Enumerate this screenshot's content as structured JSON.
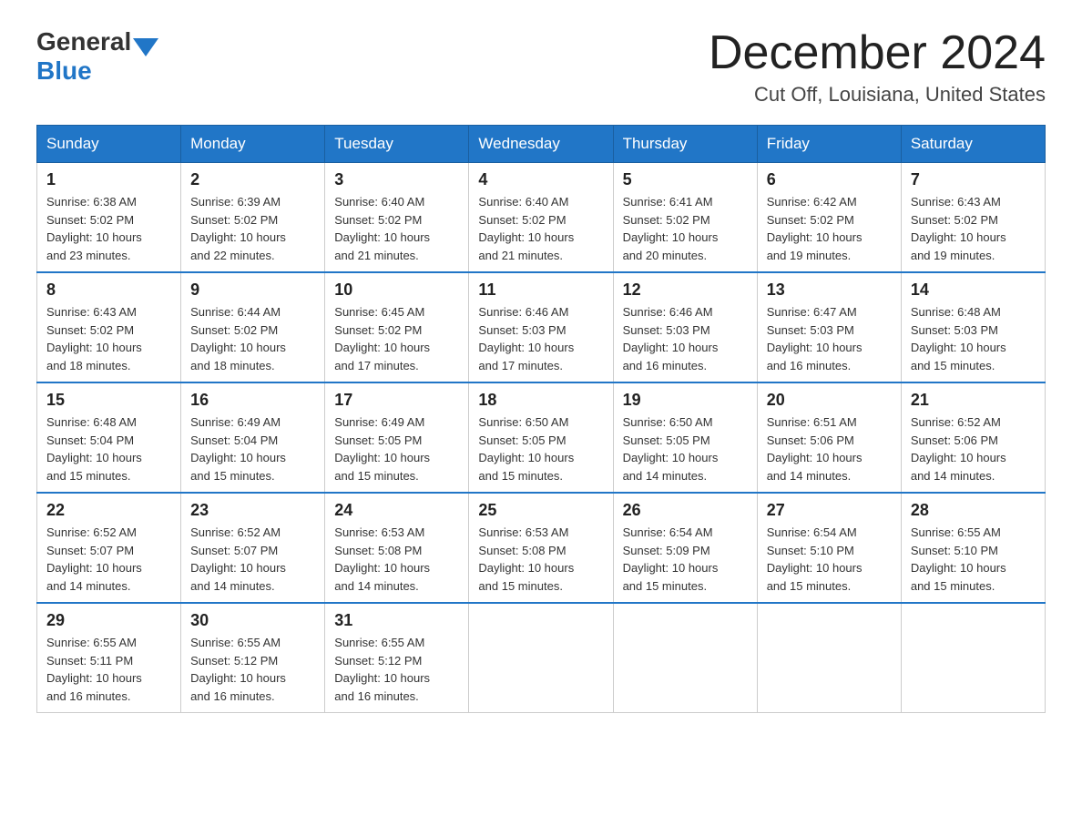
{
  "logo": {
    "general": "General",
    "blue": "Blue"
  },
  "title": {
    "month": "December 2024",
    "location": "Cut Off, Louisiana, United States"
  },
  "weekdays": [
    "Sunday",
    "Monday",
    "Tuesday",
    "Wednesday",
    "Thursday",
    "Friday",
    "Saturday"
  ],
  "weeks": [
    [
      {
        "day": "1",
        "sunrise": "6:38 AM",
        "sunset": "5:02 PM",
        "daylight": "10 hours and 23 minutes."
      },
      {
        "day": "2",
        "sunrise": "6:39 AM",
        "sunset": "5:02 PM",
        "daylight": "10 hours and 22 minutes."
      },
      {
        "day": "3",
        "sunrise": "6:40 AM",
        "sunset": "5:02 PM",
        "daylight": "10 hours and 21 minutes."
      },
      {
        "day": "4",
        "sunrise": "6:40 AM",
        "sunset": "5:02 PM",
        "daylight": "10 hours and 21 minutes."
      },
      {
        "day": "5",
        "sunrise": "6:41 AM",
        "sunset": "5:02 PM",
        "daylight": "10 hours and 20 minutes."
      },
      {
        "day": "6",
        "sunrise": "6:42 AM",
        "sunset": "5:02 PM",
        "daylight": "10 hours and 19 minutes."
      },
      {
        "day": "7",
        "sunrise": "6:43 AM",
        "sunset": "5:02 PM",
        "daylight": "10 hours and 19 minutes."
      }
    ],
    [
      {
        "day": "8",
        "sunrise": "6:43 AM",
        "sunset": "5:02 PM",
        "daylight": "10 hours and 18 minutes."
      },
      {
        "day": "9",
        "sunrise": "6:44 AM",
        "sunset": "5:02 PM",
        "daylight": "10 hours and 18 minutes."
      },
      {
        "day": "10",
        "sunrise": "6:45 AM",
        "sunset": "5:02 PM",
        "daylight": "10 hours and 17 minutes."
      },
      {
        "day": "11",
        "sunrise": "6:46 AM",
        "sunset": "5:03 PM",
        "daylight": "10 hours and 17 minutes."
      },
      {
        "day": "12",
        "sunrise": "6:46 AM",
        "sunset": "5:03 PM",
        "daylight": "10 hours and 16 minutes."
      },
      {
        "day": "13",
        "sunrise": "6:47 AM",
        "sunset": "5:03 PM",
        "daylight": "10 hours and 16 minutes."
      },
      {
        "day": "14",
        "sunrise": "6:48 AM",
        "sunset": "5:03 PM",
        "daylight": "10 hours and 15 minutes."
      }
    ],
    [
      {
        "day": "15",
        "sunrise": "6:48 AM",
        "sunset": "5:04 PM",
        "daylight": "10 hours and 15 minutes."
      },
      {
        "day": "16",
        "sunrise": "6:49 AM",
        "sunset": "5:04 PM",
        "daylight": "10 hours and 15 minutes."
      },
      {
        "day": "17",
        "sunrise": "6:49 AM",
        "sunset": "5:05 PM",
        "daylight": "10 hours and 15 minutes."
      },
      {
        "day": "18",
        "sunrise": "6:50 AM",
        "sunset": "5:05 PM",
        "daylight": "10 hours and 15 minutes."
      },
      {
        "day": "19",
        "sunrise": "6:50 AM",
        "sunset": "5:05 PM",
        "daylight": "10 hours and 14 minutes."
      },
      {
        "day": "20",
        "sunrise": "6:51 AM",
        "sunset": "5:06 PM",
        "daylight": "10 hours and 14 minutes."
      },
      {
        "day": "21",
        "sunrise": "6:52 AM",
        "sunset": "5:06 PM",
        "daylight": "10 hours and 14 minutes."
      }
    ],
    [
      {
        "day": "22",
        "sunrise": "6:52 AM",
        "sunset": "5:07 PM",
        "daylight": "10 hours and 14 minutes."
      },
      {
        "day": "23",
        "sunrise": "6:52 AM",
        "sunset": "5:07 PM",
        "daylight": "10 hours and 14 minutes."
      },
      {
        "day": "24",
        "sunrise": "6:53 AM",
        "sunset": "5:08 PM",
        "daylight": "10 hours and 14 minutes."
      },
      {
        "day": "25",
        "sunrise": "6:53 AM",
        "sunset": "5:08 PM",
        "daylight": "10 hours and 15 minutes."
      },
      {
        "day": "26",
        "sunrise": "6:54 AM",
        "sunset": "5:09 PM",
        "daylight": "10 hours and 15 minutes."
      },
      {
        "day": "27",
        "sunrise": "6:54 AM",
        "sunset": "5:10 PM",
        "daylight": "10 hours and 15 minutes."
      },
      {
        "day": "28",
        "sunrise": "6:55 AM",
        "sunset": "5:10 PM",
        "daylight": "10 hours and 15 minutes."
      }
    ],
    [
      {
        "day": "29",
        "sunrise": "6:55 AM",
        "sunset": "5:11 PM",
        "daylight": "10 hours and 16 minutes."
      },
      {
        "day": "30",
        "sunrise": "6:55 AM",
        "sunset": "5:12 PM",
        "daylight": "10 hours and 16 minutes."
      },
      {
        "day": "31",
        "sunrise": "6:55 AM",
        "sunset": "5:12 PM",
        "daylight": "10 hours and 16 minutes."
      },
      null,
      null,
      null,
      null
    ]
  ],
  "labels": {
    "sunrise": "Sunrise:",
    "sunset": "Sunset:",
    "daylight": "Daylight:"
  }
}
